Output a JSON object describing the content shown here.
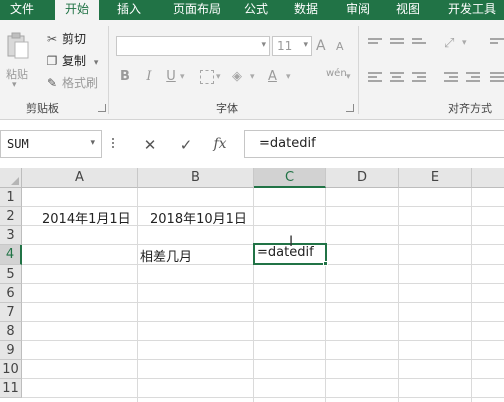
{
  "ribbon_tabs": [
    "文件",
    "开始",
    "插入",
    "页面布局",
    "公式",
    "数据",
    "审阅",
    "视图",
    "开发工具"
  ],
  "active_tab": "开始",
  "clipboard": {
    "paste": "粘贴",
    "cut": "剪切",
    "copy": "复制",
    "format_painter": "格式刷",
    "group_label": "剪贴板"
  },
  "font_group": {
    "font_size": "11",
    "bold": "B",
    "italic": "I",
    "underline": "U",
    "grow": "A",
    "shrink": "A",
    "phonetic": "wén",
    "group_label": "字体"
  },
  "alignment_group": {
    "group_label": "对齐方式"
  },
  "formula_bar": {
    "name_box": "SUM",
    "cancel": "✕",
    "enter": "✓",
    "fx": "fx",
    "content": "=datedif"
  },
  "sheet": {
    "columns": [
      "A",
      "B",
      "C",
      "D",
      "E"
    ],
    "selected_column": "C",
    "rows": [
      "1",
      "2",
      "3",
      "4",
      "5",
      "6",
      "7",
      "8",
      "9",
      "10",
      "11"
    ],
    "selected_row": "4",
    "cells": {
      "A2": "2014年1月1日",
      "B2": "2018年10月1日",
      "B4": "相差几月",
      "C4": "=datedif"
    }
  },
  "colors": {
    "accent": "#217346"
  }
}
